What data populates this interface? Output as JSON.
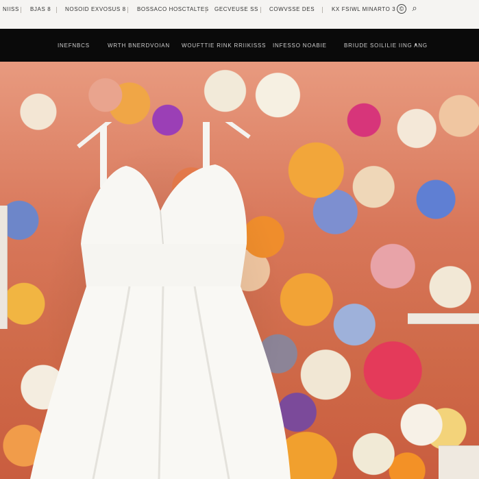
{
  "header": {
    "top_links": [
      {
        "label": "NIISS"
      },
      {
        "label": "BJAS 8"
      },
      {
        "label": "NOSOID EXVOSUS 8"
      },
      {
        "label": "BOSSACO HOSCTALTES"
      },
      {
        "label": "GECVEUSE SS"
      },
      {
        "label": "COWVSSE DES"
      }
    ],
    "account_link": "KX FSIWL MINARTO 3",
    "icons": [
      {
        "name": "user-icon",
        "glyph": "©"
      },
      {
        "name": "search-icon",
        "glyph": "⌕"
      }
    ]
  },
  "nav": {
    "items": [
      {
        "label": "INEFNBCS"
      },
      {
        "label": "WRTH BNERDVOIAN"
      },
      {
        "label": "WOUFTTIE RINK RRIIKISSS"
      },
      {
        "label": "INFESSO NOABIE"
      },
      {
        "label": "BRIUDE SOILILIE IING ANG"
      }
    ],
    "more_marker": "•"
  },
  "colors": {
    "nav_bg": "#0a0a0a",
    "topbar_bg": "#f5f4f2",
    "dress": "#f7f6f2"
  }
}
